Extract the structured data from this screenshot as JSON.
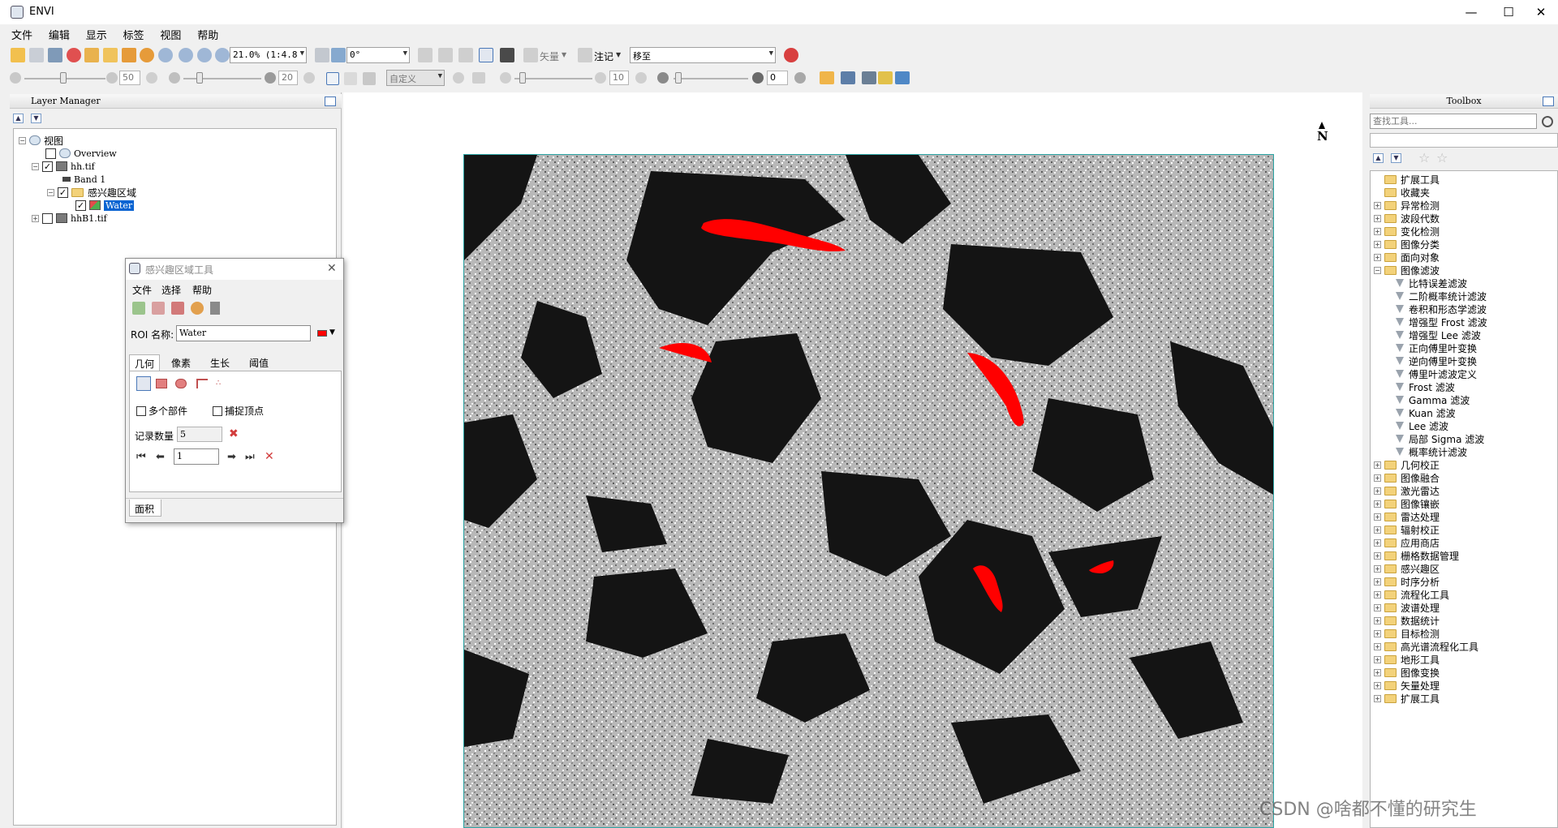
{
  "app": {
    "title": "ENVI"
  },
  "window_controls": {
    "minimize": "—",
    "maximize": "☐",
    "close": "✕"
  },
  "menu": [
    "文件",
    "编辑",
    "显示",
    "标签",
    "视图",
    "帮助"
  ],
  "toolbar1": {
    "zoom_value": "21.0% (1:4.8",
    "rotation_value": "0°",
    "vector_label": "矢量",
    "annotation_label": "注记",
    "goto_value": "移至"
  },
  "toolbar2": {
    "brightness_value": "50",
    "contrast_value": "20",
    "stretch_value": "自定义",
    "sharpen_value": "10",
    "transparency_value": "0"
  },
  "layer_manager": {
    "title": "Layer Manager",
    "nodes": [
      {
        "label": "视图"
      },
      {
        "label": "Overview"
      },
      {
        "label": "hh.tif"
      },
      {
        "label": "Band 1"
      },
      {
        "label": "感兴趣区域"
      },
      {
        "label": "Water"
      },
      {
        "label": "hhB1.tif"
      }
    ]
  },
  "toolbox": {
    "title": "Toolbox",
    "search_placeholder": "查找工具...",
    "items": [
      {
        "label": "扩展工具",
        "kind": "folder",
        "indent": 0,
        "expander": ""
      },
      {
        "label": "收藏夹",
        "kind": "folder",
        "indent": 0,
        "expander": ""
      },
      {
        "label": "异常检测",
        "kind": "folder",
        "indent": 0,
        "expander": "+"
      },
      {
        "label": "波段代数",
        "kind": "folder",
        "indent": 0,
        "expander": "+"
      },
      {
        "label": "变化检测",
        "kind": "folder",
        "indent": 0,
        "expander": "+"
      },
      {
        "label": "图像分类",
        "kind": "folder",
        "indent": 0,
        "expander": "+"
      },
      {
        "label": "面向对象",
        "kind": "folder",
        "indent": 0,
        "expander": "+"
      },
      {
        "label": "图像滤波",
        "kind": "folder",
        "indent": 0,
        "expander": "-"
      },
      {
        "label": "比特误差滤波",
        "kind": "tool",
        "indent": 1,
        "expander": ""
      },
      {
        "label": "二阶概率统计滤波",
        "kind": "tool",
        "indent": 1,
        "expander": ""
      },
      {
        "label": "卷积和形态学滤波",
        "kind": "tool",
        "indent": 1,
        "expander": ""
      },
      {
        "label": "增强型 Frost 滤波",
        "kind": "tool",
        "indent": 1,
        "expander": ""
      },
      {
        "label": "增强型 Lee 滤波",
        "kind": "tool",
        "indent": 1,
        "expander": ""
      },
      {
        "label": "正向傅里叶变换",
        "kind": "tool",
        "indent": 1,
        "expander": ""
      },
      {
        "label": "逆向傅里叶变换",
        "kind": "tool",
        "indent": 1,
        "expander": ""
      },
      {
        "label": "傅里叶滤波定义",
        "kind": "tool",
        "indent": 1,
        "expander": ""
      },
      {
        "label": "Frost 滤波",
        "kind": "tool",
        "indent": 1,
        "expander": ""
      },
      {
        "label": "Gamma 滤波",
        "kind": "tool",
        "indent": 1,
        "expander": ""
      },
      {
        "label": "Kuan 滤波",
        "kind": "tool",
        "indent": 1,
        "expander": ""
      },
      {
        "label": "Lee 滤波",
        "kind": "tool",
        "indent": 1,
        "expander": ""
      },
      {
        "label": "局部 Sigma 滤波",
        "kind": "tool",
        "indent": 1,
        "expander": ""
      },
      {
        "label": "概率统计滤波",
        "kind": "tool",
        "indent": 1,
        "expander": ""
      },
      {
        "label": "几何校正",
        "kind": "folder",
        "indent": 0,
        "expander": "+"
      },
      {
        "label": "图像融合",
        "kind": "folder",
        "indent": 0,
        "expander": "+"
      },
      {
        "label": "激光雷达",
        "kind": "folder",
        "indent": 0,
        "expander": "+"
      },
      {
        "label": "图像镶嵌",
        "kind": "folder",
        "indent": 0,
        "expander": "+"
      },
      {
        "label": "雷达处理",
        "kind": "folder",
        "indent": 0,
        "expander": "+"
      },
      {
        "label": "辐射校正",
        "kind": "folder",
        "indent": 0,
        "expander": "+"
      },
      {
        "label": "应用商店",
        "kind": "folder",
        "indent": 0,
        "expander": "+"
      },
      {
        "label": "栅格数据管理",
        "kind": "folder",
        "indent": 0,
        "expander": "+"
      },
      {
        "label": "感兴趣区",
        "kind": "folder",
        "indent": 0,
        "expander": "+"
      },
      {
        "label": "时序分析",
        "kind": "folder",
        "indent": 0,
        "expander": "+"
      },
      {
        "label": "流程化工具",
        "kind": "folder",
        "indent": 0,
        "expander": "+"
      },
      {
        "label": "波谱处理",
        "kind": "folder",
        "indent": 0,
        "expander": "+"
      },
      {
        "label": "数据统计",
        "kind": "folder",
        "indent": 0,
        "expander": "+"
      },
      {
        "label": "目标检测",
        "kind": "folder",
        "indent": 0,
        "expander": "+"
      },
      {
        "label": "高光谱流程化工具",
        "kind": "folder",
        "indent": 0,
        "expander": "+"
      },
      {
        "label": "地形工具",
        "kind": "folder",
        "indent": 0,
        "expander": "+"
      },
      {
        "label": "图像变换",
        "kind": "folder",
        "indent": 0,
        "expander": "+"
      },
      {
        "label": "矢量处理",
        "kind": "folder",
        "indent": 0,
        "expander": "+"
      },
      {
        "label": "扩展工具",
        "kind": "folder",
        "indent": 0,
        "expander": "+"
      }
    ]
  },
  "roi_tool": {
    "title": "感兴趣区域工具",
    "menu": [
      "文件",
      "选择",
      "帮助"
    ],
    "name_label": "ROI 名称:",
    "name_value": "Water",
    "roi_color": "#ff0000",
    "tabs": [
      "几何",
      "像素",
      "生长",
      "阈值"
    ],
    "multi_part_label": "多个部件",
    "snap_vertex_label": "捕捉顶点",
    "record_count_label": "记录数量",
    "record_count_value": "5",
    "record_index_value": "1",
    "bottom_tab": "面积"
  },
  "north_arrow": "N",
  "watermark": "CSDN @啥都不懂的研究生"
}
